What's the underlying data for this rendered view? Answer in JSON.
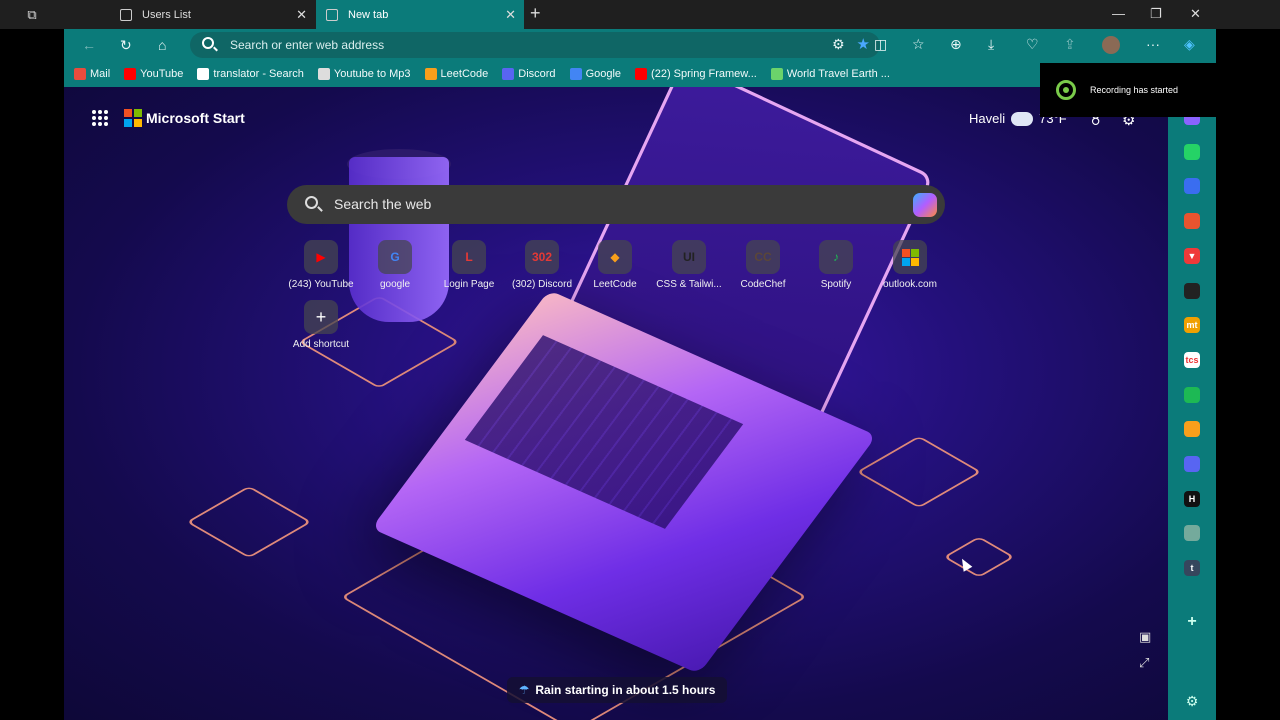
{
  "tabs": [
    {
      "label": "Users List",
      "active": false
    },
    {
      "label": "New tab",
      "active": true
    }
  ],
  "address_bar": {
    "placeholder": "Search or enter web address"
  },
  "bookmarks": [
    {
      "label": "Mail",
      "color": "#e84c3d"
    },
    {
      "label": "YouTube",
      "color": "#ff0000"
    },
    {
      "label": "translator - Search",
      "color": "#ffffff"
    },
    {
      "label": "Youtube to Mp3",
      "color": "#dddddd"
    },
    {
      "label": "LeetCode",
      "color": "#f89f1b"
    },
    {
      "label": "Discord",
      "color": "#5865f2"
    },
    {
      "label": "Google",
      "color": "#4285f4"
    },
    {
      "label": "(22) Spring Framew...",
      "color": "#ff0000"
    },
    {
      "label": "World Travel Earth ...",
      "color": "#6bd36b"
    }
  ],
  "header": {
    "brand": "Microsoft Start",
    "location": "Haveli",
    "temperature": "73°F"
  },
  "search": {
    "placeholder": "Search the web"
  },
  "shortcuts": [
    {
      "label": "(243) YouTube",
      "icon": "youtube-icon",
      "glyph": "▶",
      "color": "#ff0000"
    },
    {
      "label": "google",
      "icon": "google-icon",
      "glyph": "G",
      "color": "#4285f4"
    },
    {
      "label": "Login Page",
      "icon": "login-page-icon",
      "glyph": "L",
      "color": "#e53935"
    },
    {
      "label": "(302) Discord",
      "icon": "discord-icon",
      "glyph": "302",
      "color": "#e53935"
    },
    {
      "label": "LeetCode",
      "icon": "leetcode-icon",
      "glyph": "◆",
      "color": "#f89f1b"
    },
    {
      "label": "CSS & Tailwi...",
      "icon": "uiverse-icon",
      "glyph": "UI",
      "color": "#222222"
    },
    {
      "label": "CodeChef",
      "icon": "codechef-icon",
      "glyph": "CC",
      "color": "#5b4638"
    },
    {
      "label": "Spotify",
      "icon": "spotify-icon",
      "glyph": "♪",
      "color": "#1db954"
    },
    {
      "label": "outlook.com",
      "icon": "microsoft-icon",
      "glyph": "",
      "color": "#f25022"
    }
  ],
  "add_shortcut": {
    "label": "Add shortcut",
    "glyph": "+"
  },
  "weather_banner": {
    "text": "Rain starting in about 1.5 hours"
  },
  "toast": {
    "text": "Recording has started"
  },
  "sidebar_apps": [
    {
      "name": "copilot-icon",
      "color": "#8a63ff",
      "glyph": ""
    },
    {
      "name": "whatsapp-icon",
      "color": "#25d366",
      "glyph": ""
    },
    {
      "name": "app-icon",
      "color": "#3a6df0",
      "glyph": ""
    },
    {
      "name": "office-icon",
      "color": "#e8542f",
      "glyph": ""
    },
    {
      "name": "vivaldi-icon",
      "color": "#ef3939",
      "glyph": "▼"
    },
    {
      "name": "github-icon",
      "color": "#222222",
      "glyph": ""
    },
    {
      "name": "mt-icon",
      "color": "#f0a000",
      "glyph": "mt"
    },
    {
      "name": "tcs-icon",
      "color": "#ffffff",
      "glyph": "tcs"
    },
    {
      "name": "green-app-icon",
      "color": "#1db954",
      "glyph": ""
    },
    {
      "name": "leetcode-icon",
      "color": "#f89f1b",
      "glyph": ""
    },
    {
      "name": "discord-icon",
      "color": "#5865f2",
      "glyph": ""
    },
    {
      "name": "hackerrank-icon",
      "color": "#111111",
      "glyph": "H"
    },
    {
      "name": "chatgpt-icon",
      "color": "#74aa9c",
      "glyph": ""
    },
    {
      "name": "tumblr-icon",
      "color": "#36465d",
      "glyph": "t"
    }
  ]
}
